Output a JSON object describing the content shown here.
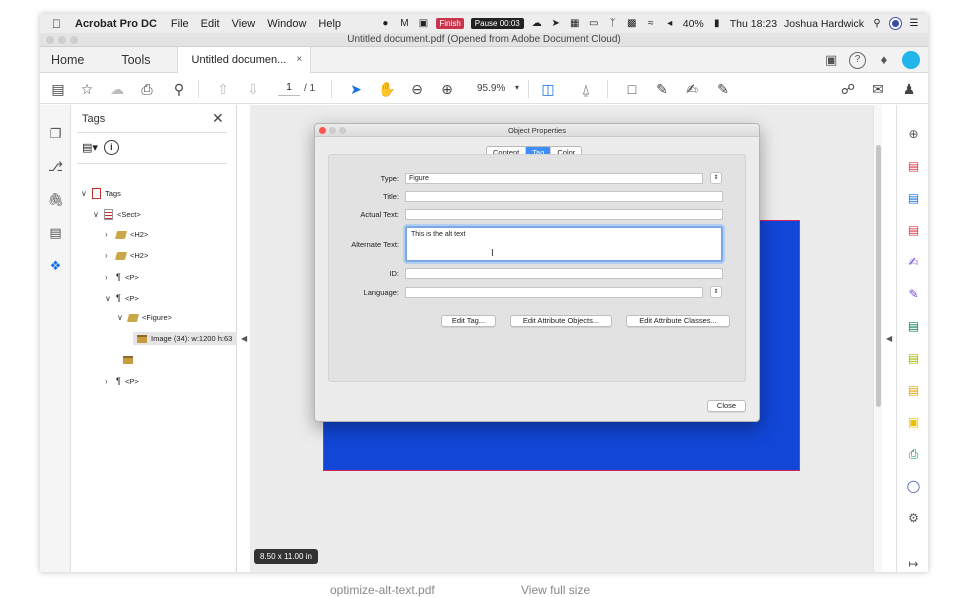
{
  "menubar": {
    "app_name": "Acrobat Pro DC",
    "menus": [
      "File",
      "Edit",
      "View",
      "Window",
      "Help"
    ],
    "finish_label": "Finish",
    "pause_label": "Pause 00:03",
    "battery": "40%",
    "clock": "Thu 18:23",
    "user": "Joshua Hardwick"
  },
  "window": {
    "title": "Untitled document.pdf (Opened from Adobe Document Cloud)"
  },
  "tabs": {
    "home": "Home",
    "tools": "Tools",
    "document": "Untitled documen...",
    "close": "×"
  },
  "toolbar": {
    "page_current": "1",
    "page_total": "/ 1",
    "zoom": "95.9%"
  },
  "tags_panel": {
    "title": "Tags",
    "close": "✕",
    "tree": [
      {
        "label": "Tags",
        "depth": 0,
        "expanded": true,
        "icon": "pdf-icon"
      },
      {
        "label": "<Sect>",
        "depth": 1,
        "expanded": true,
        "icon": "section-icon"
      },
      {
        "label": "<H2>",
        "depth": 2,
        "expanded": false,
        "icon": "tag-icon"
      },
      {
        "label": "<H2>",
        "depth": 2,
        "expanded": false,
        "icon": "tag-icon"
      },
      {
        "label": "<P>",
        "depth": 2,
        "expanded": false,
        "icon": "paragraph-icon"
      },
      {
        "label": "<P>",
        "depth": 2,
        "expanded": true,
        "icon": "paragraph-icon"
      },
      {
        "label": "<Figure>",
        "depth": 3,
        "expanded": true,
        "icon": "tag-icon"
      },
      {
        "label": "Image (34): w:1200 h:63",
        "depth": 4,
        "selected": true,
        "icon": "image-box-icon"
      },
      {
        "label": "",
        "depth": 3,
        "icon": "image-box-icon"
      },
      {
        "label": "<P>",
        "depth": 2,
        "expanded": false,
        "icon": "paragraph-icon"
      }
    ]
  },
  "document": {
    "size_badge": "8.50 x 11.00 in",
    "rect_fill": "#1146d6",
    "rect_border": "#d4245f"
  },
  "dialog": {
    "title": "Object Properties",
    "tabs": [
      {
        "label": "Content",
        "active": false
      },
      {
        "label": "Tag",
        "active": true
      },
      {
        "label": "Color",
        "active": false
      }
    ],
    "fields": {
      "type_label": "Type:",
      "type_value": "Figure",
      "title_label": "Title:",
      "title_value": "",
      "actual_text_label": "Actual Text:",
      "actual_text_value": "",
      "alt_text_label": "Alternate Text:",
      "alt_text_value": "This is the alt text",
      "id_label": "ID:",
      "id_value": "",
      "language_label": "Language:",
      "language_value": ""
    },
    "buttons": {
      "edit_tag": "Edit Tag...",
      "edit_attr_objects": "Edit Attribute Objects...",
      "edit_attr_classes": "Edit Attribute Classes...",
      "close": "Close"
    }
  },
  "caption": {
    "file": "optimize-alt-text.pdf",
    "link": "View full size"
  },
  "colors": {
    "accent": "#1473e6",
    "tab_active": "#3d8ef7"
  }
}
